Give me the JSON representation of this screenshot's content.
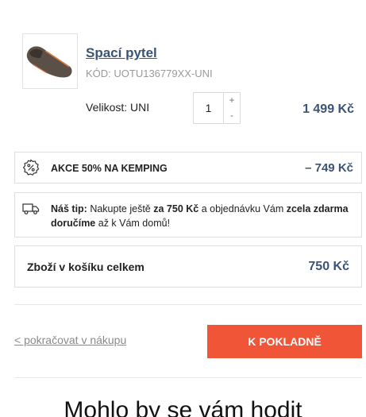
{
  "product": {
    "name": "Spací pytel",
    "code": "KÓD: UOTU136779XX-UNI",
    "size": "Velikost: UNI",
    "quantity": "1",
    "plus": "+",
    "minus": "-",
    "price": "1 499 Kč"
  },
  "promo": {
    "label": "AKCE 50% NA KEMPING",
    "value": "– 749 Kč",
    "icon": "percent-badge-icon"
  },
  "tip": {
    "icon": "truck-icon",
    "prefix": "Náš tip:",
    "part1": " Nakupte ještě ",
    "amount": "za 750 Kč",
    "part2": " a objednávku Vám ",
    "highlight": "zcela zdarma doručíme",
    "part3": " až k Vám domů!"
  },
  "summary": {
    "label": "Zboží v košíku celkem",
    "value": "750 Kč"
  },
  "actions": {
    "back_label": "< pokračovat v nákupu",
    "checkout_label": "K POKLADNĚ"
  },
  "suggestions": {
    "heading": "Mohlo by se vám hodit"
  },
  "colors": {
    "accent": "#3a5475",
    "checkout": "#f05538"
  }
}
